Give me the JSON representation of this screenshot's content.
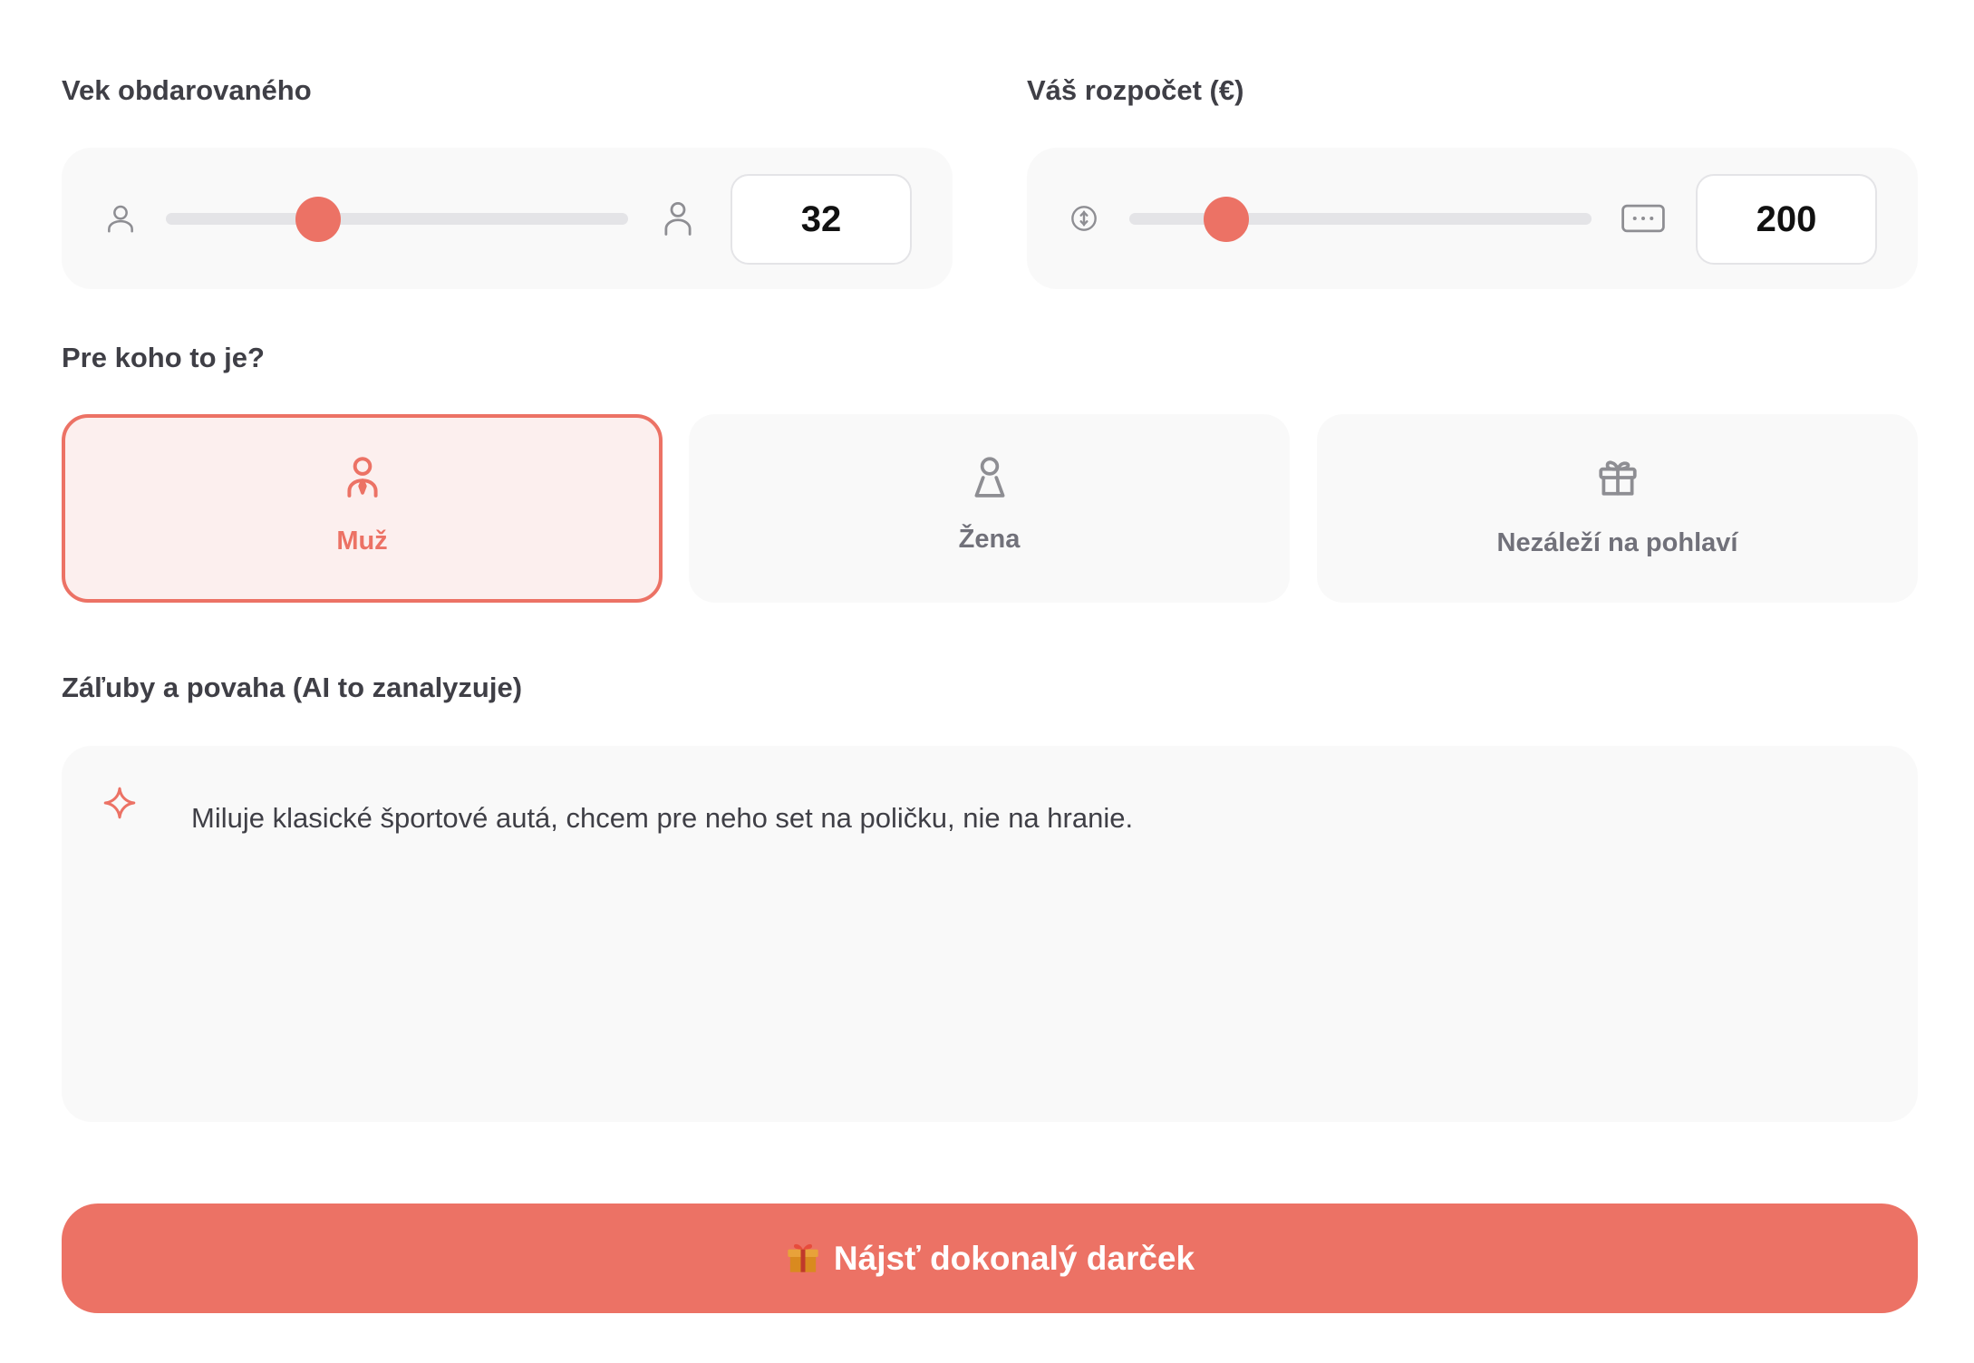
{
  "age": {
    "label": "Vek obdarovaného",
    "value": "32",
    "slider_fraction": 0.33,
    "min_icon": "person-outline-icon",
    "max_icon": "person-outline-icon"
  },
  "budget": {
    "label": "Váš rozpočet (€)",
    "value": "200",
    "slider_fraction": 0.21,
    "min_icon": "coin-icon",
    "max_icon": "banknote-icon"
  },
  "recipient": {
    "label": "Pre koho to je?",
    "options": [
      {
        "label": "Muž",
        "icon": "male-person-icon",
        "selected": true
      },
      {
        "label": "Žena",
        "icon": "female-person-icon",
        "selected": false
      },
      {
        "label": "Nezáleží na pohlaví",
        "icon": "gift-icon",
        "selected": false
      }
    ]
  },
  "hobbies": {
    "label": "Záľuby a povaha (AI to zanalyzuje)",
    "icon": "sparkle-icon",
    "value": "Miluje klasické športové autá, chcem pre neho set na poličku, nie na hranie."
  },
  "submit": {
    "label": "Nájsť dokonalý darček",
    "icon": "gift-emoji-icon"
  },
  "colors": {
    "accent": "#ec7265",
    "accent_light": "#fcefee",
    "panel": "#f9f9f9",
    "track": "#e4e4e7",
    "text": "#3f3f46",
    "muted_icon": "#8e8e93"
  }
}
